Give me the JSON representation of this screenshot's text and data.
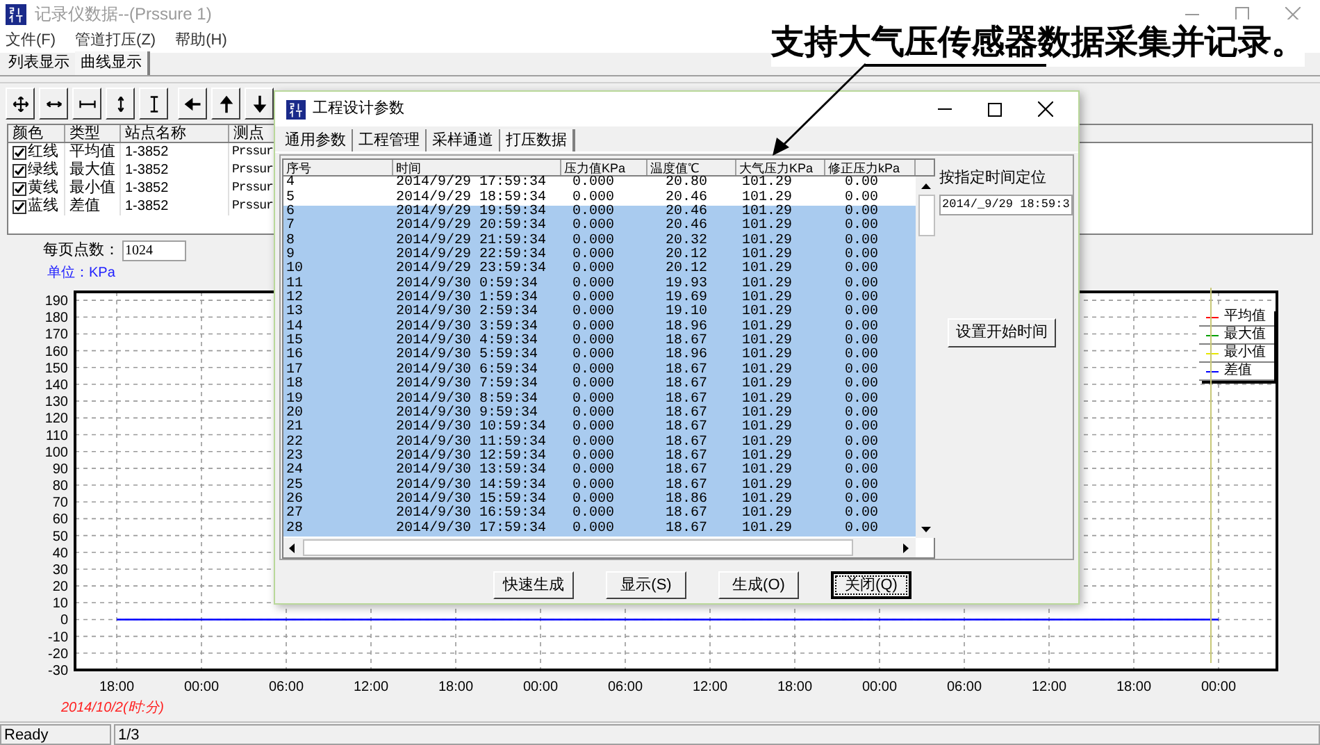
{
  "window": {
    "title": "记录仪数据--(Prssure 1)"
  },
  "menu": [
    "文件(F)",
    "管道打压(Z)",
    "帮助(H)"
  ],
  "tabs": [
    {
      "label": "列表显示",
      "selected": false
    },
    {
      "label": "曲线显示",
      "selected": true
    }
  ],
  "toolbar": [
    {
      "kind": "pan"
    },
    {
      "kind": "h-arrows"
    },
    {
      "kind": "h-bar"
    },
    {
      "kind": "v-arrows"
    },
    {
      "kind": "v-bar"
    },
    {
      "kind": "left"
    },
    {
      "kind": "up"
    },
    {
      "kind": "down"
    }
  ],
  "channel_table": {
    "columns": [
      "颜色",
      "类型",
      "站点名称",
      "测点"
    ],
    "rows": [
      {
        "checked": true,
        "line": "红线",
        "type": "平均值",
        "station": "1-3852",
        "point": "Prssur"
      },
      {
        "checked": true,
        "line": "绿线",
        "type": "最大值",
        "station": "1-3852",
        "point": "Prssur"
      },
      {
        "checked": true,
        "line": "黄线",
        "type": "最小值",
        "station": "1-3852",
        "point": "Prssur"
      },
      {
        "checked": true,
        "line": "蓝线",
        "type": "差值",
        "station": "1-3852",
        "point": "Prssur"
      }
    ]
  },
  "points_per_page": {
    "label": "每页点数：",
    "value": "1024"
  },
  "unit": "单位：KPa",
  "chart": {
    "chart_data": {
      "type": "line",
      "grid": true,
      "categories": [
        "18:00",
        "00:00",
        "06:00",
        "12:00",
        "18:00",
        "00:00",
        "06:00",
        "12:00",
        "18:00",
        "00:00",
        "06:00",
        "12:00",
        "18:00",
        "00:00"
      ],
      "ylim": [
        -30,
        195
      ],
      "yticks": [
        -30,
        -20,
        -10,
        0,
        10,
        20,
        30,
        40,
        50,
        60,
        70,
        80,
        90,
        100,
        110,
        120,
        130,
        140,
        150,
        160,
        170,
        180,
        190
      ],
      "series": [
        {
          "name": "平均值",
          "color": "#ff0000",
          "values": [
            null,
            null,
            null,
            null,
            null,
            null,
            null,
            null,
            null,
            null,
            null,
            null,
            null,
            null
          ]
        },
        {
          "name": "最大值",
          "color": "#00a000",
          "values": [
            null,
            null,
            null,
            null,
            null,
            null,
            null,
            null,
            null,
            null,
            null,
            null,
            null,
            null
          ]
        },
        {
          "name": "最小值",
          "color": "#e6e600",
          "values": [
            null,
            null,
            null,
            null,
            null,
            null,
            null,
            null,
            null,
            null,
            null,
            null,
            null,
            null
          ]
        },
        {
          "name": "差值",
          "color": "#0000ff",
          "values": [
            0,
            0,
            0,
            0,
            0,
            0,
            0,
            0,
            0,
            0,
            0,
            0,
            0,
            0
          ]
        }
      ]
    },
    "date_label": "2014/10/2(时:分)"
  },
  "dialog": {
    "title": "工程设计参数",
    "tabs": [
      {
        "label": "通用参数",
        "selected": false
      },
      {
        "label": "工程管理",
        "selected": false
      },
      {
        "label": "采样通道",
        "selected": false
      },
      {
        "label": "打压数据",
        "selected": true
      }
    ],
    "columns": [
      "序号",
      "时间",
      "压力值KPa",
      "温度值℃",
      "大气压力KPa",
      "修正压力kPa"
    ],
    "rows": [
      {
        "selected": false,
        "cells": [
          "4",
          "2014/9/29 17:59:34",
          "0.000",
          "20.80",
          "101.29",
          "0.00"
        ]
      },
      {
        "selected": false,
        "cells": [
          "5",
          "2014/9/29 18:59:34",
          "0.000",
          "20.46",
          "101.29",
          "0.00"
        ]
      },
      {
        "selected": true,
        "cells": [
          "6",
          "2014/9/29 19:59:34",
          "0.000",
          "20.46",
          "101.29",
          "0.00"
        ]
      },
      {
        "selected": true,
        "cells": [
          "7",
          "2014/9/29 20:59:34",
          "0.000",
          "20.46",
          "101.29",
          "0.00"
        ]
      },
      {
        "selected": true,
        "cells": [
          "8",
          "2014/9/29 21:59:34",
          "0.000",
          "20.32",
          "101.29",
          "0.00"
        ]
      },
      {
        "selected": true,
        "cells": [
          "9",
          "2014/9/29 22:59:34",
          "0.000",
          "20.12",
          "101.29",
          "0.00"
        ]
      },
      {
        "selected": true,
        "cells": [
          "10",
          "2014/9/29 23:59:34",
          "0.000",
          "20.12",
          "101.29",
          "0.00"
        ]
      },
      {
        "selected": true,
        "cells": [
          "11",
          "2014/9/30 0:59:34",
          "0.000",
          "19.93",
          "101.29",
          "0.00"
        ]
      },
      {
        "selected": true,
        "cells": [
          "12",
          "2014/9/30 1:59:34",
          "0.000",
          "19.69",
          "101.29",
          "0.00"
        ]
      },
      {
        "selected": true,
        "cells": [
          "13",
          "2014/9/30 2:59:34",
          "0.000",
          "19.10",
          "101.29",
          "0.00"
        ]
      },
      {
        "selected": true,
        "cells": [
          "14",
          "2014/9/30 3:59:34",
          "0.000",
          "18.96",
          "101.29",
          "0.00"
        ]
      },
      {
        "selected": true,
        "cells": [
          "15",
          "2014/9/30 4:59:34",
          "0.000",
          "18.67",
          "101.29",
          "0.00"
        ]
      },
      {
        "selected": true,
        "cells": [
          "16",
          "2014/9/30 5:59:34",
          "0.000",
          "18.96",
          "101.29",
          "0.00"
        ]
      },
      {
        "selected": true,
        "cells": [
          "17",
          "2014/9/30 6:59:34",
          "0.000",
          "18.67",
          "101.29",
          "0.00"
        ]
      },
      {
        "selected": true,
        "cells": [
          "18",
          "2014/9/30 7:59:34",
          "0.000",
          "18.67",
          "101.29",
          "0.00"
        ]
      },
      {
        "selected": true,
        "cells": [
          "19",
          "2014/9/30 8:59:34",
          "0.000",
          "18.67",
          "101.29",
          "0.00"
        ]
      },
      {
        "selected": true,
        "cells": [
          "20",
          "2014/9/30 9:59:34",
          "0.000",
          "18.67",
          "101.29",
          "0.00"
        ]
      },
      {
        "selected": true,
        "cells": [
          "21",
          "2014/9/30 10:59:34",
          "0.000",
          "18.67",
          "101.29",
          "0.00"
        ]
      },
      {
        "selected": true,
        "cells": [
          "22",
          "2014/9/30 11:59:34",
          "0.000",
          "18.67",
          "101.29",
          "0.00"
        ]
      },
      {
        "selected": true,
        "cells": [
          "23",
          "2014/9/30 12:59:34",
          "0.000",
          "18.67",
          "101.29",
          "0.00"
        ]
      },
      {
        "selected": true,
        "cells": [
          "24",
          "2014/9/30 13:59:34",
          "0.000",
          "18.67",
          "101.29",
          "0.00"
        ]
      },
      {
        "selected": true,
        "cells": [
          "25",
          "2014/9/30 14:59:34",
          "0.000",
          "18.67",
          "101.29",
          "0.00"
        ]
      },
      {
        "selected": true,
        "cells": [
          "26",
          "2014/9/30 15:59:34",
          "0.000",
          "18.86",
          "101.29",
          "0.00"
        ]
      },
      {
        "selected": true,
        "cells": [
          "27",
          "2014/9/30 16:59:34",
          "0.000",
          "18.67",
          "101.29",
          "0.00"
        ]
      },
      {
        "selected": true,
        "cells": [
          "28",
          "2014/9/30 17:59:34",
          "0.000",
          "18.67",
          "101.29",
          "0.00"
        ]
      }
    ],
    "locate_label": "按指定时间定位",
    "locate_value": "2014/_9/29 18:59:3",
    "set_start_button": "设置开始时间",
    "buttons": [
      {
        "label": "快速生成",
        "focused": false
      },
      {
        "label": "显示(S)",
        "focused": false
      },
      {
        "label": "生成(O)",
        "focused": false
      },
      {
        "label": "关闭(Q)",
        "focused": true
      }
    ]
  },
  "annotation": "支持大气压传感器数据采集并记录。",
  "status_bar": [
    "Ready",
    "1/3"
  ]
}
